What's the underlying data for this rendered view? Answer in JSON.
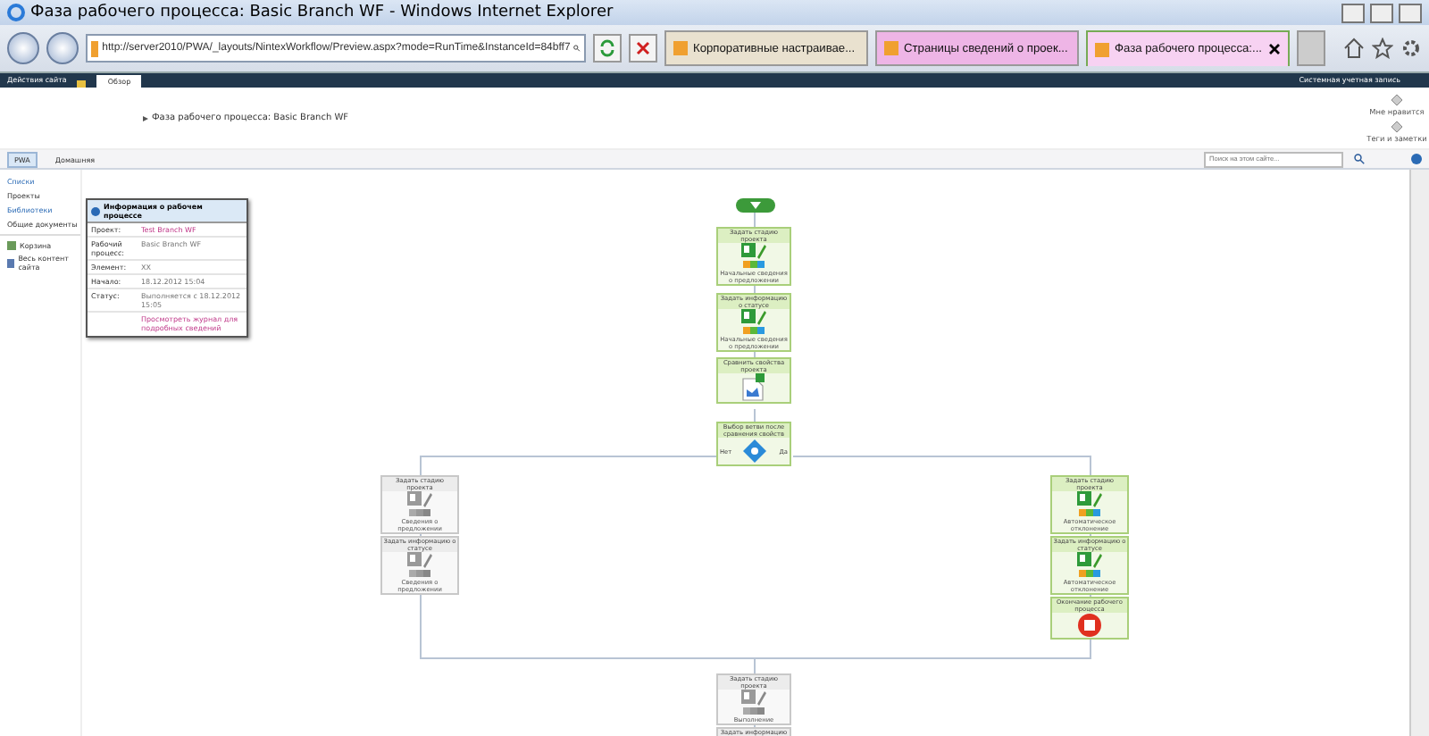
{
  "window": {
    "title": "Фаза рабочего процесса: Basic Branch WF - Windows Internet Explorer"
  },
  "address_bar": {
    "url": "http://server2010/PWA/_layouts/NintexWorkflow/Preview.aspx?mode=RunTime&InstanceId=84bff7"
  },
  "browser_tabs": [
    {
      "label": "Корпоративные настраивае...",
      "selected": false,
      "color": "#e9e1cf"
    },
    {
      "label": "Страницы сведений о проек...",
      "selected": false,
      "color": "#eeb5e6"
    },
    {
      "label": "Фаза рабочего процесса:...",
      "selected": true,
      "color": "#f7d2f2"
    }
  ],
  "ribbon": {
    "site_actions": "Действия сайта",
    "tabs": [
      {
        "label": "Обзор",
        "selected": true
      }
    ],
    "user": "Системная учетная запись",
    "breadcrumb": "Фаза рабочего процесса: Basic Branch WF",
    "actions": [
      "Мне нравится",
      "Теги и заметки"
    ]
  },
  "top_nav": {
    "items": [
      {
        "label": "PWA",
        "selected": true
      },
      {
        "label": "Домашняя",
        "selected": false
      }
    ],
    "search": {
      "placeholder": "Поиск на этом сайте..."
    }
  },
  "quick_launch": {
    "sections": [
      {
        "heading": "Списки",
        "items": [
          "Проекты"
        ]
      },
      {
        "heading": "Библиотеки",
        "items": [
          "Общие документы"
        ]
      }
    ],
    "links": [
      {
        "label": "Корзина",
        "kind": "recycle"
      },
      {
        "label": "Весь контент сайта",
        "kind": "content"
      }
    ]
  },
  "info_panel": {
    "title": "Информация о рабочем процессе",
    "rows": [
      {
        "label": "Проект:",
        "value": "Test Branch WF",
        "kind": "link"
      },
      {
        "label": "Рабочий процесс:",
        "value": "Basic Branch WF",
        "kind": "text"
      },
      {
        "label": "Элемент:",
        "value": "XX",
        "kind": "text"
      },
      {
        "label": "Начало:",
        "value": "18.12.2012 15:04",
        "kind": "text"
      },
      {
        "label": "Статус:",
        "value": "Выполняется с 18.12.2012 15:05",
        "kind": "text"
      }
    ],
    "link": "Просмотреть журнал для подробных сведений"
  },
  "workflow": {
    "main": [
      {
        "title": "Задать стадию проекта",
        "caption": "Начальные сведения о предложении",
        "kind": "project",
        "completed": true
      },
      {
        "title": "Задать информацию о статусе",
        "caption": "Начальные сведения о предложении",
        "kind": "project",
        "completed": true
      },
      {
        "title": "Сравнить свойства проекта",
        "kind": "document",
        "completed": true
      }
    ],
    "branch": {
      "title": "Выбор ветви после сравнения свойств",
      "completed": true,
      "no_label": "Нет",
      "yes_label": "Да"
    },
    "no_branch": [
      {
        "title": "Задать стадию проекта",
        "caption": "Сведения о предложении",
        "kind": "project",
        "completed": false
      },
      {
        "title": "Задать информацию о статусе",
        "caption": "Сведения о предложении",
        "kind": "project",
        "completed": false
      }
    ],
    "yes_branch": [
      {
        "title": "Задать стадию проекта",
        "caption": "Автоматическое отклонение",
        "kind": "project",
        "completed": true
      },
      {
        "title": "Задать информацию о статусе",
        "caption": "Автоматическое отклонение",
        "kind": "project",
        "completed": true
      },
      {
        "title": "Окончание рабочего процесса",
        "kind": "stop",
        "completed": true
      }
    ],
    "after": [
      {
        "title": "Задать стадию проекта",
        "caption": "Выполнение",
        "kind": "project",
        "completed": false
      },
      {
        "title": "Задать информацию",
        "completed": false
      }
    ]
  }
}
